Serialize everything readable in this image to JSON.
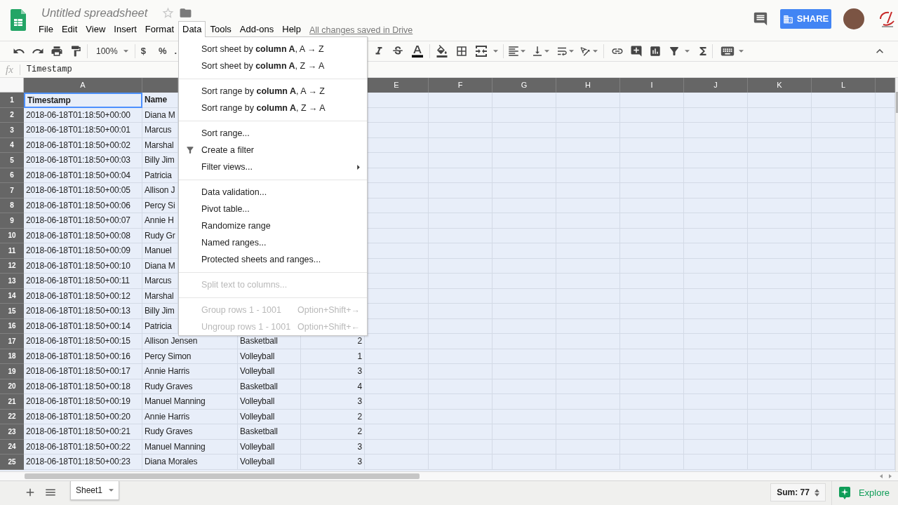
{
  "header": {
    "title": "Untitled spreadsheet",
    "starred": false,
    "menus": [
      {
        "label": "File",
        "open": false
      },
      {
        "label": "Edit",
        "open": false
      },
      {
        "label": "View",
        "open": false
      },
      {
        "label": "Insert",
        "open": false
      },
      {
        "label": "Format",
        "open": false
      },
      {
        "label": "Data",
        "open": true,
        "items": [
          {
            "kind": "item",
            "label": "Sort sheet by **column A**, A → Z",
            "disabled": false
          },
          {
            "kind": "item",
            "label": "Sort sheet by **column A**, Z → A",
            "disabled": false
          },
          {
            "kind": "separator"
          },
          {
            "kind": "item",
            "label": "Sort range by **column A**, A → Z",
            "disabled": false
          },
          {
            "kind": "item",
            "label": "Sort range by **column A**, Z → A",
            "disabled": false
          },
          {
            "kind": "separator"
          },
          {
            "kind": "item",
            "label": "Sort range...",
            "disabled": false
          },
          {
            "kind": "filter",
            "label": "Create a filter",
            "disabled": false
          },
          {
            "kind": "submenu",
            "label": "Filter views...",
            "disabled": false
          },
          {
            "kind": "separator"
          },
          {
            "kind": "item",
            "label": "Data validation...",
            "disabled": false
          },
          {
            "kind": "item",
            "label": "Pivot table...",
            "disabled": false
          },
          {
            "kind": "item",
            "label": "Randomize range",
            "disabled": false
          },
          {
            "kind": "item",
            "label": "Named ranges...",
            "disabled": false
          },
          {
            "kind": "item",
            "label": "Protected sheets and ranges...",
            "disabled": false
          },
          {
            "kind": "separator"
          },
          {
            "kind": "item",
            "label": "Split text to columns...",
            "disabled": true
          },
          {
            "kind": "separator"
          },
          {
            "kind": "item",
            "label": "Group rows 1 - 1001",
            "shortcut": "Option+Shift+→",
            "disabled": true
          },
          {
            "kind": "item",
            "label": "Ungroup rows 1 - 1001",
            "shortcut": "Option+Shift+←",
            "disabled": true
          }
        ]
      },
      {
        "label": "Tools",
        "open": false
      },
      {
        "label": "Add-ons",
        "open": false
      },
      {
        "label": "Help",
        "open": false
      }
    ],
    "save_status": "All changes saved in Drive",
    "share_button": "SHARE"
  },
  "toolbar": {
    "zoom": "100%",
    "currency": "$",
    "percent": "%",
    "decimal": "."
  },
  "formula_bar": {
    "label": "fx",
    "value": "Timestamp"
  },
  "grid": {
    "all_selected": true,
    "columns": [
      {
        "label": "A"
      },
      {},
      {},
      {},
      {
        "label": "E"
      },
      {
        "label": "F"
      },
      {
        "label": "G"
      },
      {
        "label": "H"
      },
      {
        "label": "I"
      },
      {
        "label": "J"
      },
      {
        "label": "K"
      },
      {
        "label": "L"
      },
      {}
    ],
    "rows": [
      {
        "number": "1",
        "cells": [
          {
            "text": "Timestamp",
            "active": true
          },
          {
            "text": "Name",
            "active": false
          }
        ]
      },
      {
        "number": "2",
        "cells": [
          {
            "text": "2018-06-18T01:18:50+00:00",
            "active": false
          },
          {
            "text": "Diana M",
            "active": false
          }
        ]
      },
      {
        "number": "3",
        "cells": [
          {
            "text": "2018-06-18T01:18:50+00:01",
            "active": false
          },
          {
            "text": "Marcus",
            "active": false
          }
        ]
      },
      {
        "number": "4",
        "cells": [
          {
            "text": "2018-06-18T01:18:50+00:02",
            "active": false
          },
          {
            "text": "Marshal",
            "active": false
          }
        ]
      },
      {
        "number": "5",
        "cells": [
          {
            "text": "2018-06-18T01:18:50+00:03",
            "active": false
          },
          {
            "text": "Billy Jim",
            "active": false
          }
        ]
      },
      {
        "number": "6",
        "cells": [
          {
            "text": "2018-06-18T01:18:50+00:04",
            "active": false
          },
          {
            "text": "Patricia",
            "active": false
          }
        ]
      },
      {
        "number": "7",
        "cells": [
          {
            "text": "2018-06-18T01:18:50+00:05",
            "active": false
          },
          {
            "text": "Allison J",
            "active": false
          }
        ]
      },
      {
        "number": "8",
        "cells": [
          {
            "text": "2018-06-18T01:18:50+00:06",
            "active": false
          },
          {
            "text": "Percy Si",
            "active": false
          }
        ]
      },
      {
        "number": "9",
        "cells": [
          {
            "text": "2018-06-18T01:18:50+00:07",
            "active": false
          },
          {
            "text": "Annie H",
            "active": false
          }
        ]
      },
      {
        "number": "10",
        "cells": [
          {
            "text": "2018-06-18T01:18:50+00:08",
            "active": false
          },
          {
            "text": "Rudy Gr",
            "active": false
          }
        ]
      },
      {
        "number": "11",
        "cells": [
          {
            "text": "2018-06-18T01:18:50+00:09",
            "active": false
          },
          {
            "text": "Manuel",
            "active": false
          }
        ]
      },
      {
        "number": "12",
        "cells": [
          {
            "text": "2018-06-18T01:18:50+00:10",
            "active": false
          },
          {
            "text": "Diana M",
            "active": false
          }
        ]
      },
      {
        "number": "13",
        "cells": [
          {
            "text": "2018-06-18T01:18:50+00:11",
            "active": false
          },
          {
            "text": "Marcus",
            "active": false
          }
        ]
      },
      {
        "number": "14",
        "cells": [
          {
            "text": "2018-06-18T01:18:50+00:12",
            "active": false
          },
          {
            "text": "Marshal",
            "active": false
          }
        ]
      },
      {
        "number": "15",
        "cells": [
          {
            "text": "2018-06-18T01:18:50+00:13",
            "active": false
          },
          {
            "text": "Billy Jim",
            "active": false
          }
        ]
      },
      {
        "number": "16",
        "cells": [
          {
            "text": "2018-06-18T01:18:50+00:14",
            "active": false
          },
          {
            "text": "Patricia",
            "active": false
          }
        ]
      },
      {
        "number": "17",
        "cells": [
          {
            "text": "2018-06-18T01:18:50+00:15",
            "active": false
          },
          {
            "text": "Allison Jensen",
            "active": false
          },
          {
            "text": "Basketball",
            "active": false
          },
          {
            "text": "2",
            "active": false
          }
        ]
      },
      {
        "number": "18",
        "cells": [
          {
            "text": "2018-06-18T01:18:50+00:16",
            "active": false
          },
          {
            "text": "Percy Simon",
            "active": false
          },
          {
            "text": "Volleyball",
            "active": false
          },
          {
            "text": "1",
            "active": false
          }
        ]
      },
      {
        "number": "19",
        "cells": [
          {
            "text": "2018-06-18T01:18:50+00:17",
            "active": false
          },
          {
            "text": "Annie Harris",
            "active": false
          },
          {
            "text": "Volleyball",
            "active": false
          },
          {
            "text": "3",
            "active": false
          }
        ]
      },
      {
        "number": "20",
        "cells": [
          {
            "text": "2018-06-18T01:18:50+00:18",
            "active": false
          },
          {
            "text": "Rudy Graves",
            "active": false
          },
          {
            "text": "Basketball",
            "active": false
          },
          {
            "text": "4",
            "active": false
          }
        ]
      },
      {
        "number": "21",
        "cells": [
          {
            "text": "2018-06-18T01:18:50+00:19",
            "active": false
          },
          {
            "text": "Manuel Manning",
            "active": false
          },
          {
            "text": "Volleyball",
            "active": false
          },
          {
            "text": "3",
            "active": false
          }
        ]
      },
      {
        "number": "22",
        "cells": [
          {
            "text": "2018-06-18T01:18:50+00:20",
            "active": false
          },
          {
            "text": "Annie Harris",
            "active": false
          },
          {
            "text": "Volleyball",
            "active": false
          },
          {
            "text": "2",
            "active": false
          }
        ]
      },
      {
        "number": "23",
        "cells": [
          {
            "text": "2018-06-18T01:18:50+00:21",
            "active": false
          },
          {
            "text": "Rudy Graves",
            "active": false
          },
          {
            "text": "Basketball",
            "active": false
          },
          {
            "text": "2",
            "active": false
          }
        ]
      },
      {
        "number": "24",
        "cells": [
          {
            "text": "2018-06-18T01:18:50+00:22",
            "active": false
          },
          {
            "text": "Manuel Manning",
            "active": false
          },
          {
            "text": "Volleyball",
            "active": false
          },
          {
            "text": "3",
            "active": false
          }
        ]
      },
      {
        "number": "25",
        "cells": [
          {
            "text": "2018-06-18T01:18:50+00:23",
            "active": false
          },
          {
            "text": "Diana Morales",
            "active": false
          },
          {
            "text": "Volleyball",
            "active": false
          },
          {
            "text": "3",
            "active": false
          }
        ]
      }
    ]
  },
  "bottom_bar": {
    "sheets": [
      {
        "name": "Sheet1",
        "selected": true
      }
    ],
    "sum": "Sum: 77",
    "explore": "Explore"
  }
}
